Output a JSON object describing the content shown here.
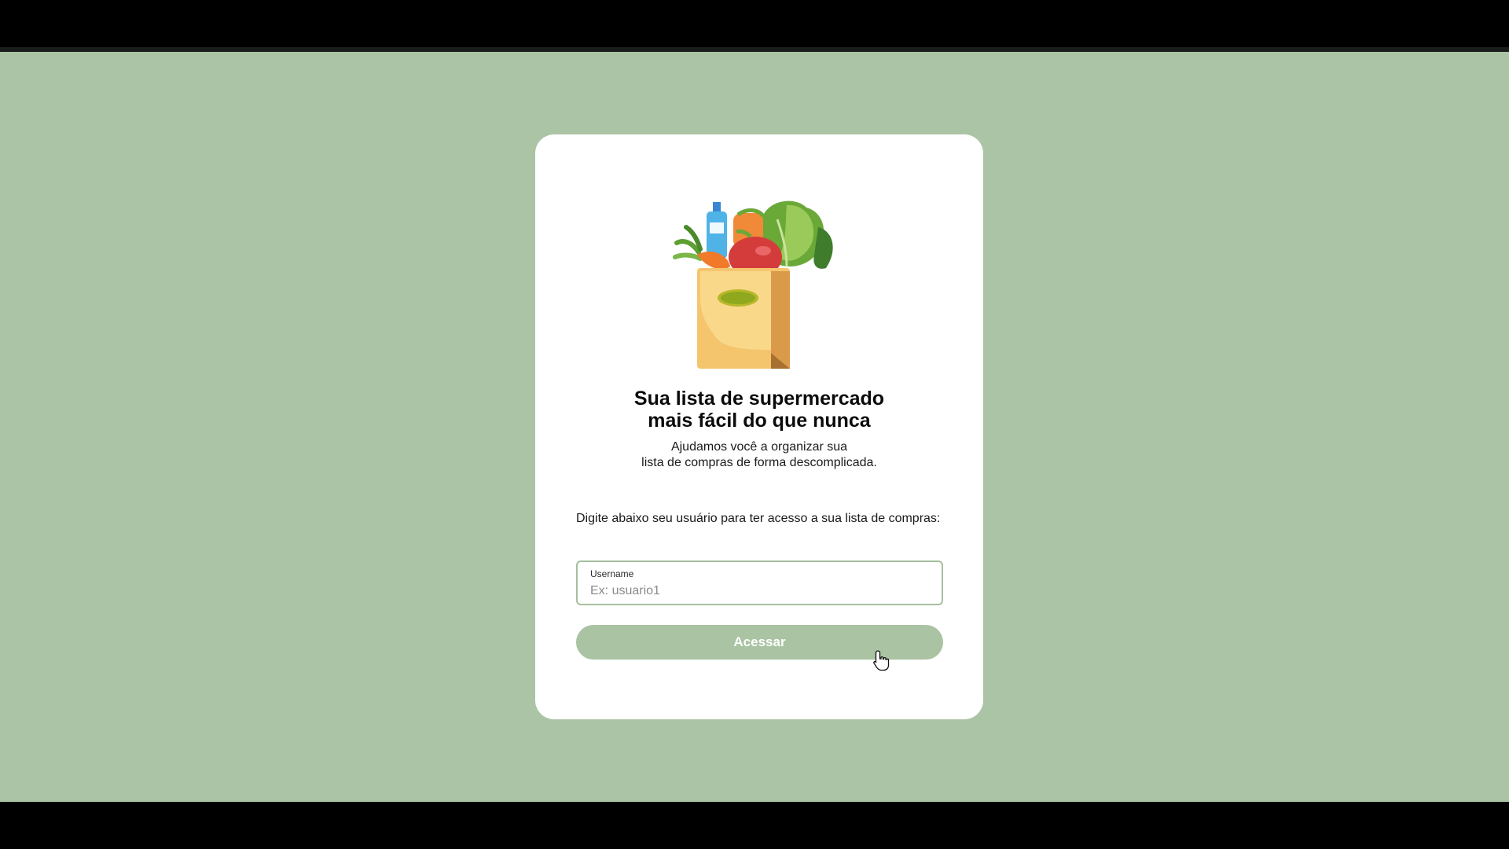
{
  "hero": {
    "icon": "grocery-bag-icon"
  },
  "headline": {
    "line1": "Sua lista de supermercado",
    "line2": "mais fácil do que nunca"
  },
  "subtitle": {
    "line1": "Ajudamos você a organizar sua",
    "line2": "lista de compras de forma descomplicada."
  },
  "login": {
    "instruction": "Digite abaixo seu usuário para ter acesso a sua lista de compras:",
    "username_label": "Username",
    "username_placeholder": "Ex: usuario1",
    "username_value": "",
    "submit_label": "Acessar"
  },
  "colors": {
    "background": "#abc4a5",
    "card": "#ffffff",
    "accent": "#a9c3a3",
    "text": "#0b0b0b"
  }
}
